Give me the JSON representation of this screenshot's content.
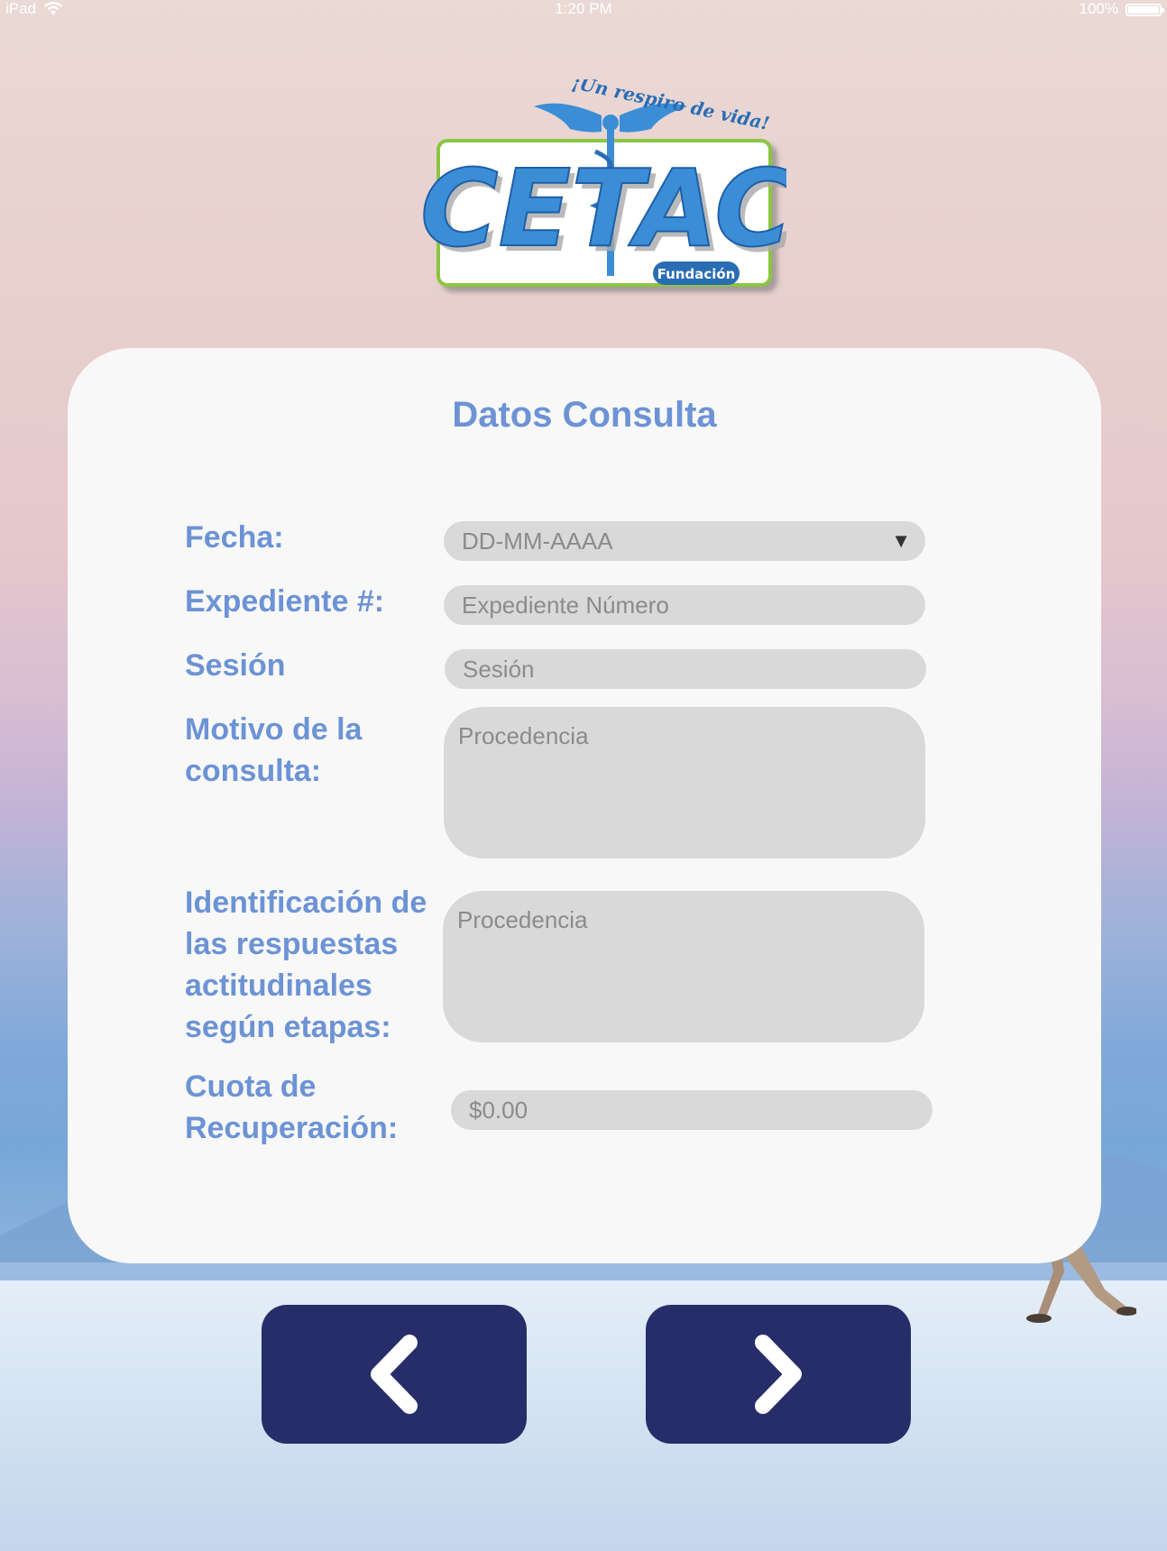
{
  "status_bar": {
    "device": "iPad",
    "time": "1:20 PM",
    "battery": "100%",
    "icons": [
      "wifi-icon",
      "battery-icon"
    ]
  },
  "logo": {
    "brand": "CETAC",
    "tagline": "¡Un respiro de vida!",
    "badge": "Fundación"
  },
  "form": {
    "title": "Datos Consulta",
    "fecha": {
      "label": "Fecha:",
      "placeholder": "DD-MM-AAAA",
      "icon": "dropdown-triangle-icon"
    },
    "expediente": {
      "label": "Expediente #:",
      "placeholder": "Expediente Número"
    },
    "sesion": {
      "label": "Sesión",
      "placeholder": "Sesión"
    },
    "motivo": {
      "label_line1": "Motivo de la",
      "label_line2": "consulta:",
      "placeholder": "Procedencia"
    },
    "identificacion": {
      "label_line1": "Identificación de",
      "label_line2": "las respuestas",
      "label_line3": "actitudinales",
      "label_line4": "según etapas:",
      "placeholder": "Procedencia"
    },
    "cuota": {
      "label_line1": "Cuota de",
      "label_line2": "Recuperación:",
      "placeholder": "$0.00"
    }
  },
  "navigation": {
    "back_icon": "chevron-left-icon",
    "next_icon": "chevron-right-icon"
  },
  "colors": {
    "label": "#6c93d5",
    "button": "#262d69",
    "card": "#f8f8f8",
    "field": "#d9d9d9"
  }
}
